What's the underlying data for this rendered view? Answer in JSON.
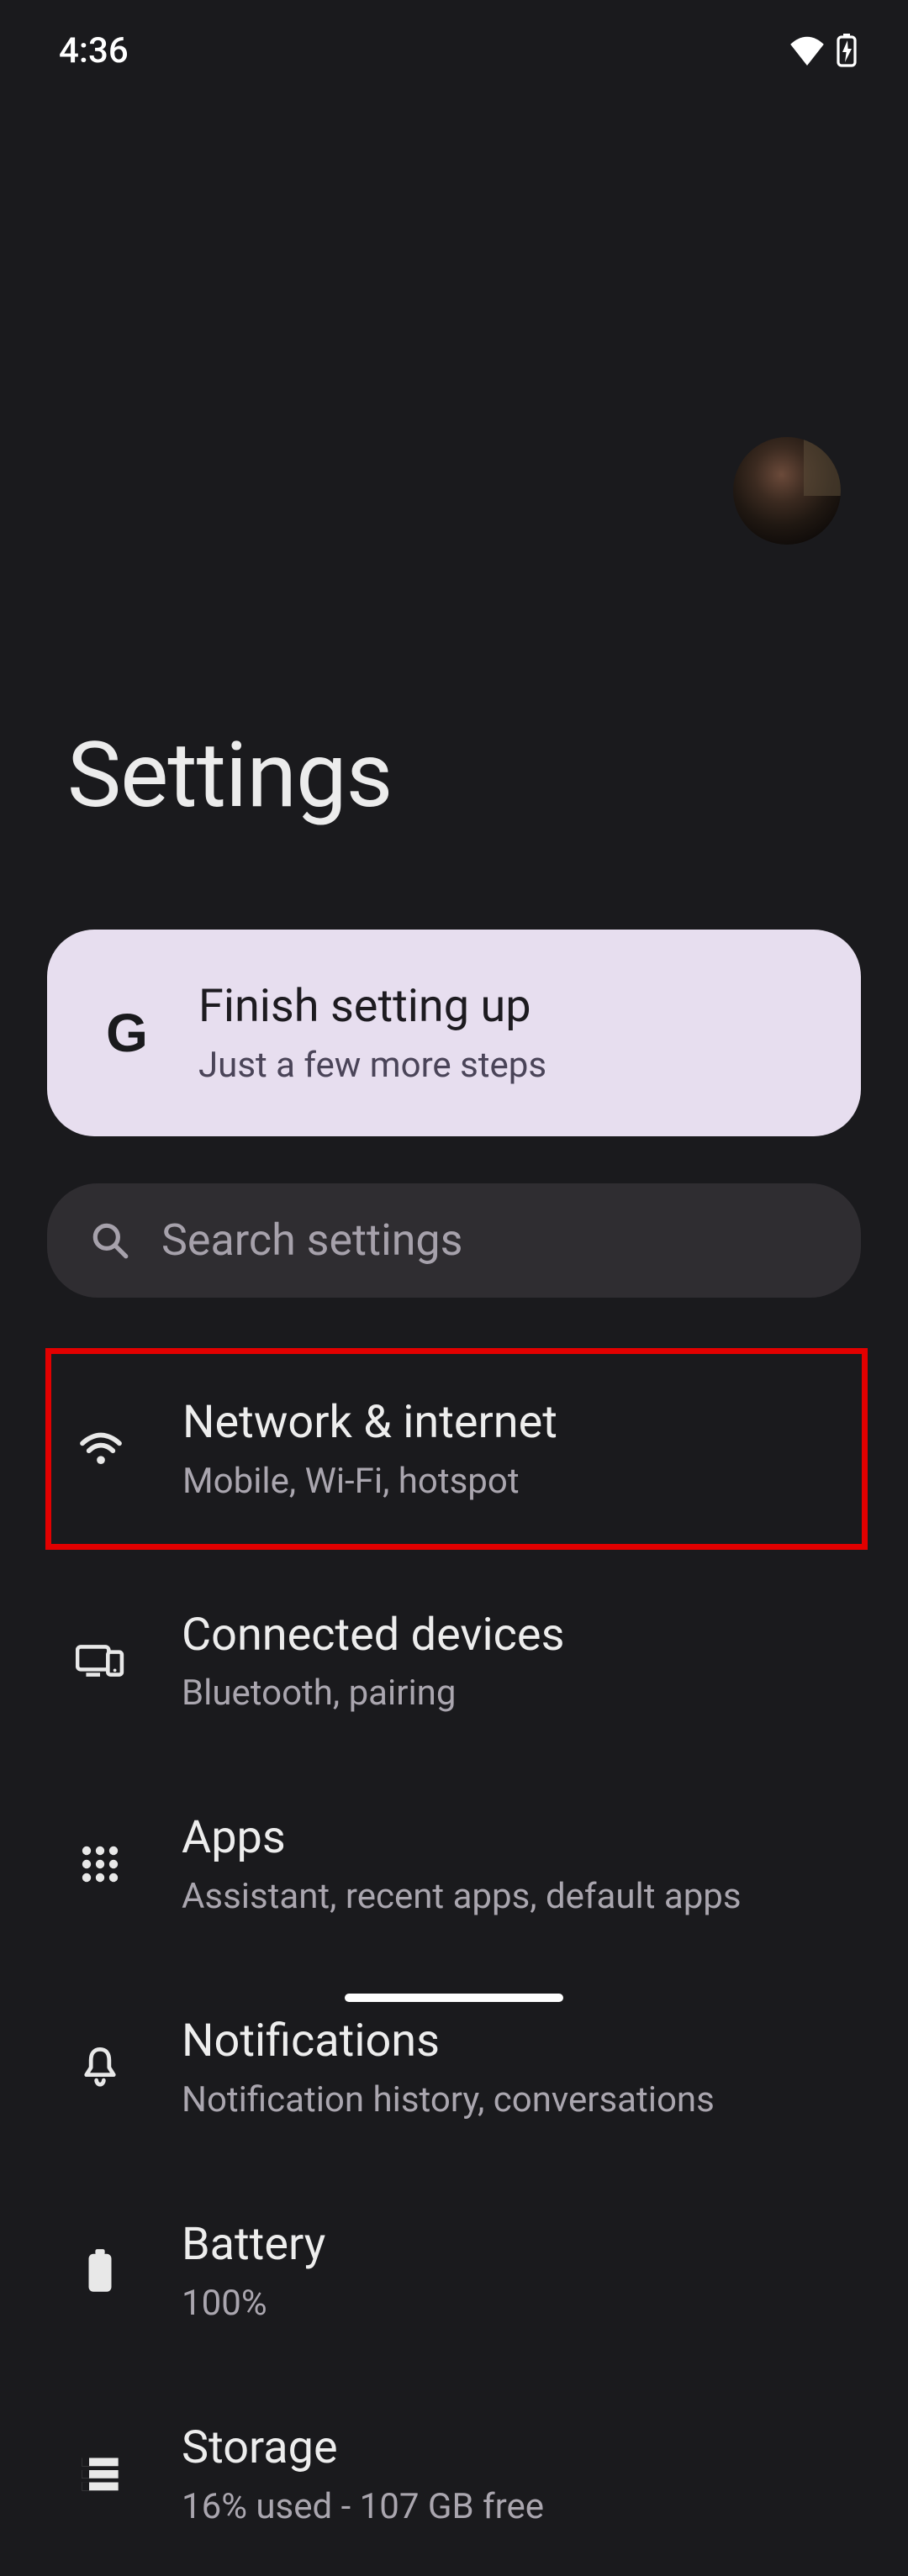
{
  "status": {
    "time": "4:36"
  },
  "page": {
    "title": "Settings"
  },
  "banner": {
    "title": "Finish setting up",
    "sub": "Just a few more steps"
  },
  "search": {
    "placeholder": "Search settings"
  },
  "items": [
    {
      "title": "Network & internet",
      "sub": "Mobile, Wi-Fi, hotspot"
    },
    {
      "title": "Connected devices",
      "sub": "Bluetooth, pairing"
    },
    {
      "title": "Apps",
      "sub": "Assistant, recent apps, default apps"
    },
    {
      "title": "Notifications",
      "sub": "Notification history, conversations"
    },
    {
      "title": "Battery",
      "sub": "100%"
    },
    {
      "title": "Storage",
      "sub": "16% used - 107 GB free"
    }
  ]
}
